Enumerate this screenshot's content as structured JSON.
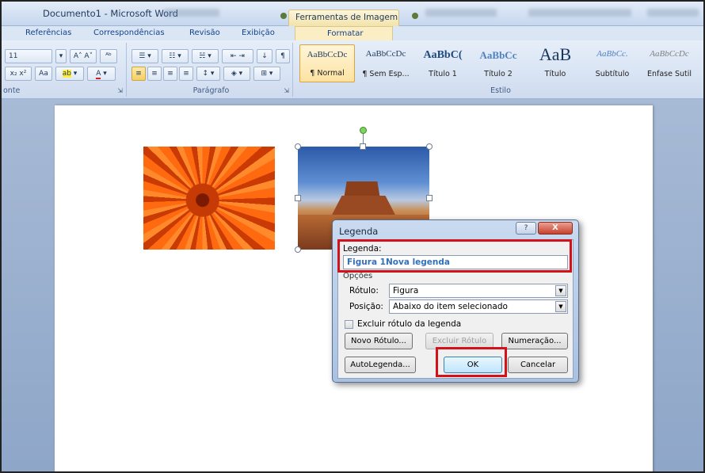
{
  "window": {
    "title": "Documento1 - Microsoft Word",
    "tool_tab": "Ferramentas de Imagem"
  },
  "ribbon_tabs": {
    "referencias": "Referências",
    "correspondencias": "Correspondências",
    "revisao": "Revisão",
    "exibicao": "Exibição",
    "formatar": "Formatar"
  },
  "ribbon": {
    "font_size": "11",
    "group_fonte": "onte",
    "group_paragrafo": "Parágrafo",
    "group_estilo": "Estilo",
    "styles": [
      {
        "sample": "AaBbCcDc",
        "name": "¶ Normal"
      },
      {
        "sample": "AaBbCcDc",
        "name": "¶ Sem Esp..."
      },
      {
        "sample": "AaBbC(",
        "name": "Título 1"
      },
      {
        "sample": "AaBbCc",
        "name": "Título 2"
      },
      {
        "sample": "AaB",
        "name": "Título"
      },
      {
        "sample": "AaBbCc.",
        "name": "Subtítulo"
      },
      {
        "sample": "AaBbCcDc",
        "name": "Ênfase Sutil"
      }
    ]
  },
  "dialog": {
    "title": "Legenda",
    "help": "?",
    "close": "X",
    "legend_label": "Legenda:",
    "legend_value": "Figura 1Nova legenda",
    "options_label": "Opções",
    "rotulo_label": "Rótulo:",
    "rotulo_value": "Figura",
    "posicao_label": "Posição:",
    "posicao_value": "Abaixo do item selecionado",
    "exclude_label": "Excluir rótulo da legenda",
    "btn_novo_rotulo": "Novo Rótulo...",
    "btn_excluir_rotulo": "Excluir Rótulo",
    "btn_numeracao": "Numeração...",
    "btn_autolegenda": "AutoLegenda...",
    "btn_ok": "OK",
    "btn_cancelar": "Cancelar"
  },
  "colors": {
    "highlight": "#d4111b",
    "legend_text": "#3470b8"
  }
}
